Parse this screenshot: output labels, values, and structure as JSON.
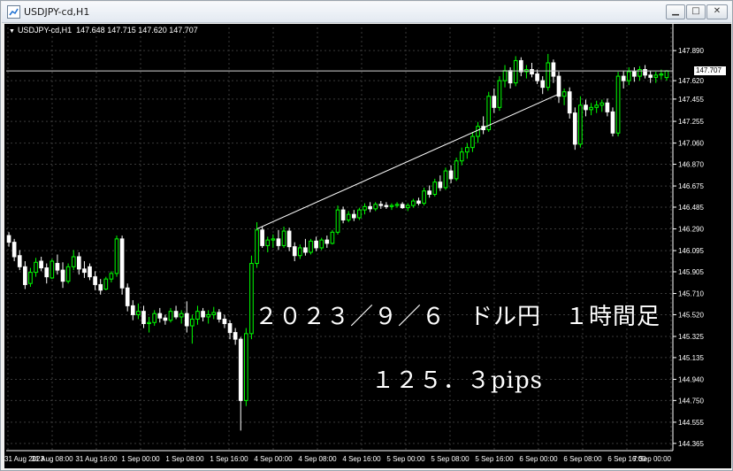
{
  "window": {
    "title": "USDJPY-cd,H1",
    "controls": {
      "minimize": "▁",
      "maximize": "□",
      "close": "✕"
    }
  },
  "header": {
    "symbol": "USDJPY-cd,H1",
    "ohlc": "147.648 147.715 147.620 147.707"
  },
  "current_price": "147.707",
  "annotations": {
    "title": "２０２３／９／６　ドル円　１時間足",
    "pips": "１２５．３pips"
  },
  "colors": {
    "background": "#000000",
    "grid": "#3a3a3a",
    "bull": "#00ff00",
    "bear": "#ffffff",
    "text": "#ffffff",
    "trendline": "#ffffff"
  },
  "chart_data": {
    "type": "candlestick",
    "y_ticks": [
      "147.890",
      "147.620",
      "147.455",
      "147.255",
      "147.060",
      "146.870",
      "146.675",
      "146.485",
      "146.290",
      "146.095",
      "145.905",
      "145.710",
      "145.520",
      "145.325",
      "145.135",
      "144.940",
      "144.750",
      "144.555",
      "144.365"
    ],
    "x_ticks": [
      "31 Aug 2023",
      "31 Aug 08:00",
      "31 Aug 16:00",
      "1 Sep 00:00",
      "1 Sep 08:00",
      "1 Sep 16:00",
      "4 Sep 00:00",
      "4 Sep 08:00",
      "4 Sep 16:00",
      "5 Sep 00:00",
      "5 Sep 08:00",
      "5 Sep 16:00",
      "6 Sep 00:00",
      "6 Sep 08:00",
      "6 Sep 16:00",
      "7 Sep 00:00"
    ],
    "ylim": [
      144.3,
      148.05
    ],
    "last_price": 147.707,
    "trendline": {
      "from": 146.29,
      "to": 147.5
    },
    "candles": [
      [
        146.23,
        146.26,
        146.13,
        146.17
      ],
      [
        146.17,
        146.2,
        146.0,
        146.04
      ],
      [
        146.05,
        146.1,
        145.92,
        145.95
      ],
      [
        145.95,
        146.0,
        145.75,
        145.79
      ],
      [
        145.8,
        145.94,
        145.77,
        145.9
      ],
      [
        145.9,
        146.03,
        145.86,
        145.99
      ],
      [
        146.0,
        146.04,
        145.91,
        145.94
      ],
      [
        145.94,
        145.98,
        145.8,
        145.86
      ],
      [
        145.85,
        146.02,
        145.84,
        146.0
      ],
      [
        145.98,
        146.06,
        145.88,
        145.92
      ],
      [
        145.92,
        145.99,
        145.76,
        145.82
      ],
      [
        145.82,
        145.98,
        145.8,
        145.95
      ],
      [
        145.95,
        146.1,
        145.92,
        146.04
      ],
      [
        146.04,
        146.08,
        145.88,
        145.93
      ],
      [
        145.93,
        146.0,
        145.85,
        145.9
      ],
      [
        145.95,
        145.98,
        145.83,
        145.86
      ],
      [
        145.86,
        145.91,
        145.74,
        145.79
      ],
      [
        145.79,
        145.84,
        145.7,
        145.74
      ],
      [
        145.75,
        145.86,
        145.74,
        145.84
      ],
      [
        145.84,
        145.91,
        145.81,
        145.89
      ],
      [
        145.89,
        146.23,
        145.86,
        146.2
      ],
      [
        146.2,
        146.23,
        145.7,
        145.76
      ],
      [
        145.76,
        145.8,
        145.55,
        145.6
      ],
      [
        145.6,
        145.65,
        145.47,
        145.52
      ],
      [
        145.52,
        145.62,
        145.48,
        145.55
      ],
      [
        145.55,
        145.6,
        145.4,
        145.44
      ],
      [
        145.44,
        145.5,
        145.36,
        145.45
      ],
      [
        145.45,
        145.56,
        145.42,
        145.53
      ],
      [
        145.53,
        145.58,
        145.45,
        145.49
      ],
      [
        145.49,
        145.52,
        145.43,
        145.47
      ],
      [
        145.47,
        145.58,
        145.45,
        145.55
      ],
      [
        145.55,
        145.6,
        145.48,
        145.5
      ],
      [
        145.5,
        145.56,
        145.44,
        145.53
      ],
      [
        145.53,
        145.64,
        145.36,
        145.42
      ],
      [
        145.42,
        145.52,
        145.26,
        145.48
      ],
      [
        145.48,
        145.6,
        145.43,
        145.55
      ],
      [
        145.55,
        145.58,
        145.46,
        145.5
      ],
      [
        145.5,
        145.56,
        145.44,
        145.52
      ],
      [
        145.52,
        145.59,
        145.48,
        145.54
      ],
      [
        145.54,
        145.57,
        145.45,
        145.48
      ],
      [
        145.48,
        145.52,
        145.4,
        145.44
      ],
      [
        145.44,
        145.47,
        145.3,
        145.36
      ],
      [
        145.36,
        145.4,
        145.25,
        145.3
      ],
      [
        145.3,
        145.32,
        144.48,
        144.75
      ],
      [
        144.75,
        145.4,
        144.7,
        145.35
      ],
      [
        145.35,
        146.05,
        145.3,
        145.98
      ],
      [
        145.98,
        146.35,
        145.94,
        146.28
      ],
      [
        146.28,
        146.31,
        146.12,
        146.14
      ],
      [
        146.14,
        146.22,
        146.08,
        146.19
      ],
      [
        146.19,
        146.24,
        146.12,
        146.2
      ],
      [
        146.2,
        146.28,
        146.1,
        146.14
      ],
      [
        146.14,
        146.31,
        146.12,
        146.27
      ],
      [
        146.27,
        146.3,
        146.09,
        146.13
      ],
      [
        146.13,
        146.17,
        146.0,
        146.05
      ],
      [
        146.05,
        146.15,
        146.02,
        146.12
      ],
      [
        146.12,
        146.2,
        146.05,
        146.08
      ],
      [
        146.08,
        146.2,
        146.06,
        146.18
      ],
      [
        146.18,
        146.22,
        146.09,
        146.12
      ],
      [
        146.12,
        146.21,
        146.1,
        146.19
      ],
      [
        146.19,
        146.23,
        146.12,
        146.16
      ],
      [
        146.16,
        146.28,
        146.15,
        146.26
      ],
      [
        146.26,
        146.5,
        146.24,
        146.46
      ],
      [
        146.46,
        146.49,
        146.34,
        146.37
      ],
      [
        146.37,
        146.45,
        146.35,
        146.42
      ],
      [
        146.42,
        146.46,
        146.36,
        146.39
      ],
      [
        146.39,
        146.48,
        146.37,
        146.46
      ],
      [
        146.46,
        146.52,
        146.42,
        146.49
      ],
      [
        146.49,
        146.53,
        146.44,
        146.47
      ],
      [
        146.47,
        146.53,
        146.45,
        146.51
      ],
      [
        146.51,
        146.54,
        146.47,
        146.5
      ],
      [
        146.5,
        146.53,
        146.47,
        146.49
      ],
      [
        146.49,
        146.52,
        146.46,
        146.5
      ],
      [
        146.5,
        146.53,
        146.48,
        146.51
      ],
      [
        146.51,
        146.53,
        146.47,
        146.48
      ],
      [
        146.48,
        146.52,
        146.45,
        146.5
      ],
      [
        146.5,
        146.56,
        146.48,
        146.54
      ],
      [
        146.54,
        146.57,
        146.5,
        146.52
      ],
      [
        146.52,
        146.66,
        146.5,
        146.63
      ],
      [
        146.63,
        146.68,
        146.57,
        146.6
      ],
      [
        146.6,
        146.74,
        146.58,
        146.71
      ],
      [
        146.71,
        146.77,
        146.63,
        146.66
      ],
      [
        146.66,
        146.84,
        146.64,
        146.81
      ],
      [
        146.81,
        146.86,
        146.7,
        146.74
      ],
      [
        146.74,
        146.93,
        146.72,
        146.9
      ],
      [
        146.9,
        147.02,
        146.86,
        146.98
      ],
      [
        146.98,
        147.06,
        146.92,
        147.02
      ],
      [
        147.02,
        147.16,
        146.98,
        147.12
      ],
      [
        147.12,
        147.25,
        147.06,
        147.21
      ],
      [
        147.21,
        147.3,
        147.14,
        147.18
      ],
      [
        147.18,
        147.52,
        147.16,
        147.48
      ],
      [
        147.48,
        147.55,
        147.33,
        147.38
      ],
      [
        147.38,
        147.66,
        147.35,
        147.62
      ],
      [
        147.62,
        147.76,
        147.56,
        147.71
      ],
      [
        147.71,
        147.74,
        147.55,
        147.6
      ],
      [
        147.6,
        147.84,
        147.57,
        147.8
      ],
      [
        147.8,
        147.83,
        147.66,
        147.7
      ],
      [
        147.7,
        147.76,
        147.64,
        147.72
      ],
      [
        147.72,
        147.78,
        147.65,
        147.68
      ],
      [
        147.68,
        147.72,
        147.59,
        147.62
      ],
      [
        147.62,
        147.66,
        147.5,
        147.56
      ],
      [
        147.56,
        147.86,
        147.53,
        147.78
      ],
      [
        147.78,
        147.81,
        147.6,
        147.66
      ],
      [
        147.66,
        147.7,
        147.42,
        147.48
      ],
      [
        147.48,
        147.55,
        147.4,
        147.52
      ],
      [
        147.52,
        147.56,
        147.28,
        147.33
      ],
      [
        147.33,
        147.38,
        147.0,
        147.05
      ],
      [
        147.05,
        147.48,
        147.02,
        147.4
      ],
      [
        147.4,
        147.45,
        147.3,
        147.36
      ],
      [
        147.36,
        147.42,
        147.31,
        147.38
      ],
      [
        147.38,
        147.44,
        147.33,
        147.4
      ],
      [
        147.4,
        147.45,
        147.34,
        147.42
      ],
      [
        147.42,
        147.46,
        147.3,
        147.34
      ],
      [
        147.34,
        147.38,
        147.12,
        147.15
      ],
      [
        147.15,
        147.7,
        147.12,
        147.66
      ],
      [
        147.66,
        147.71,
        147.55,
        147.62
      ],
      [
        147.62,
        147.74,
        147.58,
        147.7
      ],
      [
        147.7,
        147.74,
        147.61,
        147.66
      ],
      [
        147.66,
        147.75,
        147.62,
        147.72
      ],
      [
        147.72,
        147.76,
        147.64,
        147.67
      ],
      [
        147.67,
        147.71,
        147.6,
        147.65
      ],
      [
        147.65,
        147.7,
        147.6,
        147.67
      ],
      [
        147.67,
        147.72,
        147.63,
        147.68
      ],
      [
        147.648,
        147.715,
        147.62,
        147.707
      ]
    ]
  }
}
